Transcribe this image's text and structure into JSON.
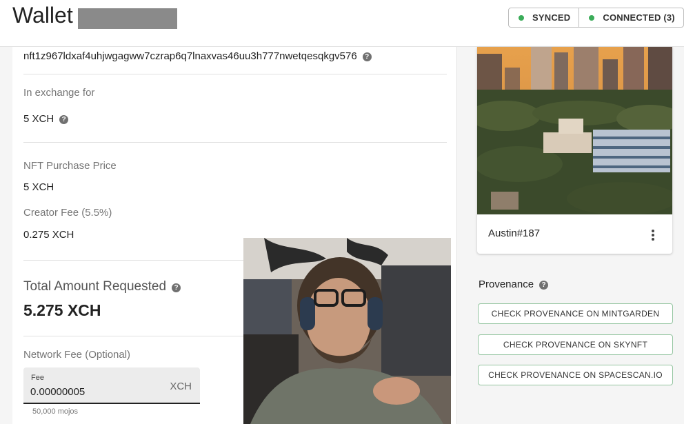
{
  "header": {
    "title": "Wallet",
    "status": [
      {
        "label": "SYNCED",
        "color": "#3aac59"
      },
      {
        "label": "CONNECTED (3)",
        "color": "#3aac59"
      }
    ]
  },
  "offer": {
    "nft_id": "nft1z967ldxaf4uhjwgagww7czrap6q7lnaxvas46uu3h777nwetqesqkgv576",
    "exchange_label": "In exchange for",
    "exchange_value": "5 XCH",
    "purchase_label": "NFT Purchase Price",
    "purchase_value": "5 XCH",
    "creator_label": "Creator Fee (5.5%)",
    "creator_value": "0.275 XCH",
    "total_label": "Total Amount Requested",
    "total_value": "5.275 XCH",
    "network_fee_label": "Network Fee (Optional)",
    "fee": {
      "label": "Fee",
      "value": "0.00000005",
      "unit": "XCH",
      "helper": "50,000 mojos"
    }
  },
  "nft": {
    "name": "Austin#187",
    "provenance_title": "Provenance",
    "buttons": [
      "CHECK PROVENANCE ON MINTGARDEN",
      "CHECK PROVENANCE ON SKYNFT",
      "CHECK PROVENANCE ON SPACESCAN.IO"
    ]
  },
  "icons": {
    "help": "help-circle-icon",
    "menu": "more-vert-icon",
    "status": "status-dot-icon"
  }
}
